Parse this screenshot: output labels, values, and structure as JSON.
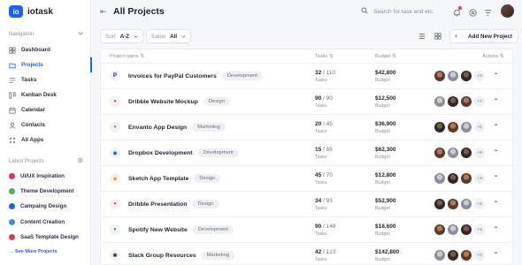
{
  "app": {
    "logo_mark": "io",
    "name": "iotask"
  },
  "sidebar": {
    "nav_label": "Navigation",
    "nav_items": [
      {
        "label": "Dashboard",
        "icon": "dashboard-icon"
      },
      {
        "label": "Projects",
        "icon": "folder-icon",
        "active": true
      },
      {
        "label": "Tasks",
        "icon": "tasks-icon"
      },
      {
        "label": "Kanban Desk",
        "icon": "kanban-icon"
      },
      {
        "label": "Calendar",
        "icon": "calendar-icon"
      },
      {
        "label": "Contacts",
        "icon": "contacts-icon"
      },
      {
        "label": "All Apps",
        "icon": "apps-icon"
      }
    ],
    "latest_label": "Latest Projects",
    "latest_projects": [
      {
        "label": "UI/UX Inspiration",
        "color": "#d6336c"
      },
      {
        "label": "Theme Development",
        "color": "#4caf50"
      },
      {
        "label": "Campaing Design",
        "color": "#1e61eb"
      },
      {
        "label": "Content Creation",
        "color": "#4285f4"
      },
      {
        "label": "SaaS Template Design",
        "color": "#e53950"
      }
    ],
    "see_more": "See More Projects"
  },
  "header": {
    "title": "All Projects",
    "search_placeholder": "Search for task and etc."
  },
  "toolbar": {
    "sort_label": "Sort",
    "sort_value": "A-Z",
    "status_label": "Satus",
    "status_value": "All",
    "add_label": "Add New Project",
    "add_plus": "+"
  },
  "table": {
    "headers": {
      "name": "Project name",
      "tasks": "Tasks",
      "budget": "Budget",
      "actions": "Actions"
    },
    "tasks_sub": "Tasks",
    "budget_sub": "Budget",
    "rows": [
      {
        "name": "Invoices for PayPal Customers",
        "tag": "Development",
        "done": "32",
        "total": "/ 110",
        "budget": "$42,800",
        "more": "+3",
        "icon": "paypal-icon",
        "icon_glyph": "P",
        "icon_color": "#0b2f6b"
      },
      {
        "name": "Dribble Website Mockup",
        "tag": "Design",
        "done": "90",
        "total": "/ 90",
        "budget": "$12,500",
        "more": "+7",
        "icon": "dribbble-icon",
        "icon_glyph": "●",
        "icon_color": "#e14a84"
      },
      {
        "name": "Envanto App Design",
        "tag": "Marketing",
        "done": "20",
        "total": "/ 45",
        "budget": "$36,900",
        "more": "+5",
        "icon": "envato-icon",
        "icon_glyph": "●",
        "icon_color": "#5aa83c"
      },
      {
        "name": "Dropbox Development",
        "tag": "Development",
        "done": "15",
        "total": "/ 65",
        "budget": "$62,300",
        "more": "+9",
        "icon": "dropbox-icon",
        "icon_glyph": "◆",
        "icon_color": "#1e61eb"
      },
      {
        "name": "Sketch App Template",
        "tag": "Design",
        "done": "45",
        "total": "/ 70",
        "budget": "$12,800",
        "more": "+3",
        "icon": "sketch-icon",
        "icon_glyph": "◆",
        "icon_color": "#f4a623"
      },
      {
        "name": "Dribble Presentation",
        "tag": "Design",
        "done": "34",
        "total": "/ 93",
        "budget": "$52,900",
        "more": "+3",
        "icon": "dribbble-icon",
        "icon_glyph": "●",
        "icon_color": "#e14a84"
      },
      {
        "name": "Spotify New Website",
        "tag": "Development",
        "done": "90",
        "total": "/ 148",
        "budget": "$18,600",
        "more": "+3",
        "icon": "spotify-icon",
        "icon_glyph": "●",
        "icon_color": "#1db954"
      },
      {
        "name": "Slack Group Resources",
        "tag": "Marketing",
        "done": "42",
        "total": "/ 123",
        "budget": "$142,800",
        "more": "+3",
        "icon": "slack-icon",
        "icon_glyph": "✱",
        "icon_color": "#611f69"
      }
    ]
  },
  "colors": {
    "accent": "#1e61eb",
    "text": "#1e2233",
    "muted": "#8a90a0"
  }
}
